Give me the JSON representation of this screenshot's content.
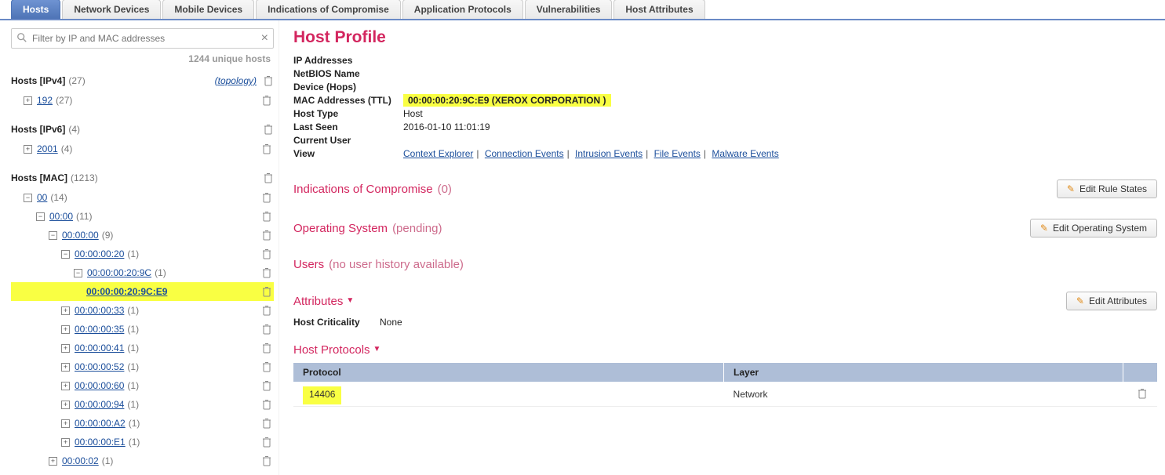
{
  "tabs": {
    "hosts": "Hosts",
    "network_devices": "Network Devices",
    "mobile_devices": "Mobile Devices",
    "ioc": "Indications of Compromise",
    "app_protocols": "Application Protocols",
    "vulnerabilities": "Vulnerabilities",
    "host_attributes": "Host Attributes"
  },
  "filter": {
    "placeholder": "Filter by IP and MAC addresses",
    "unique_hosts": "1244 unique hosts"
  },
  "tree": {
    "ipv4_label": "Hosts [IPv4]",
    "ipv4_count": "(27)",
    "ipv4_topology": "(topology)",
    "ipv4_items": [
      {
        "label": "192",
        "count": "(27)",
        "sign": "+"
      }
    ],
    "ipv6_label": "Hosts [IPv6]",
    "ipv6_count": "(4)",
    "ipv6_items": [
      {
        "label": "2001",
        "count": "(4)",
        "sign": "+"
      }
    ],
    "mac_label": "Hosts [MAC]",
    "mac_count": "(1213)",
    "mac_l1": {
      "label": "00",
      "count": "(14)",
      "sign": "−"
    },
    "mac_l2": {
      "label": "00:00",
      "count": "(11)",
      "sign": "−"
    },
    "mac_l3": {
      "label": "00:00:00",
      "count": "(9)",
      "sign": "−"
    },
    "mac_l4": {
      "label": "00:00:00:20",
      "count": "(1)",
      "sign": "−"
    },
    "mac_l5": {
      "label": "00:00:00:20:9C",
      "count": "(1)",
      "sign": "−"
    },
    "mac_sel": {
      "label": "00:00:00:20:9C:E9"
    },
    "mac_siblings": [
      {
        "label": "00:00:00:33",
        "count": "(1)"
      },
      {
        "label": "00:00:00:35",
        "count": "(1)"
      },
      {
        "label": "00:00:00:41",
        "count": "(1)"
      },
      {
        "label": "00:00:00:52",
        "count": "(1)"
      },
      {
        "label": "00:00:00:60",
        "count": "(1)"
      },
      {
        "label": "00:00:00:94",
        "count": "(1)"
      },
      {
        "label": "00:00:00:A2",
        "count": "(1)"
      },
      {
        "label": "00:00:00:E1",
        "count": "(1)"
      }
    ],
    "mac_l2b": {
      "label": "00:00:02",
      "count": "(1)"
    }
  },
  "profile": {
    "title": "Host Profile",
    "ip_label": "IP Addresses",
    "ip_value": "",
    "netbios_label": "NetBIOS Name",
    "netbios_value": "",
    "device_label": "Device (Hops)",
    "device_value": "",
    "mac_label": "MAC Addresses (TTL)",
    "mac_value": "00:00:00:20:9C:E9 (XEROX CORPORATION )",
    "hosttype_label": "Host Type",
    "hosttype_value": "Host",
    "lastseen_label": "Last Seen",
    "lastseen_value": "2016-01-10 11:01:19",
    "curuser_label": "Current User",
    "curuser_value": "",
    "view_label": "View",
    "view_context": "Context Explorer",
    "view_conn": "Connection Events",
    "view_intr": "Intrusion Events",
    "view_file": "File Events",
    "view_mal": "Malware Events"
  },
  "sections": {
    "ioc_title": "Indications of Compromise",
    "ioc_sub": "(0)",
    "ioc_btn": "Edit Rule States",
    "os_title": "Operating System",
    "os_sub": "(pending)",
    "os_btn": "Edit Operating System",
    "users_title": "Users",
    "users_sub": "(no user history available)",
    "attr_title": "Attributes",
    "attr_btn": "Edit Attributes",
    "attr_crit_label": "Host Criticality",
    "attr_crit_value": "None",
    "proto_title": "Host Protocols",
    "proto_th_protocol": "Protocol",
    "proto_th_layer": "Layer",
    "proto_row_protocol": "14406",
    "proto_row_layer": "Network"
  }
}
